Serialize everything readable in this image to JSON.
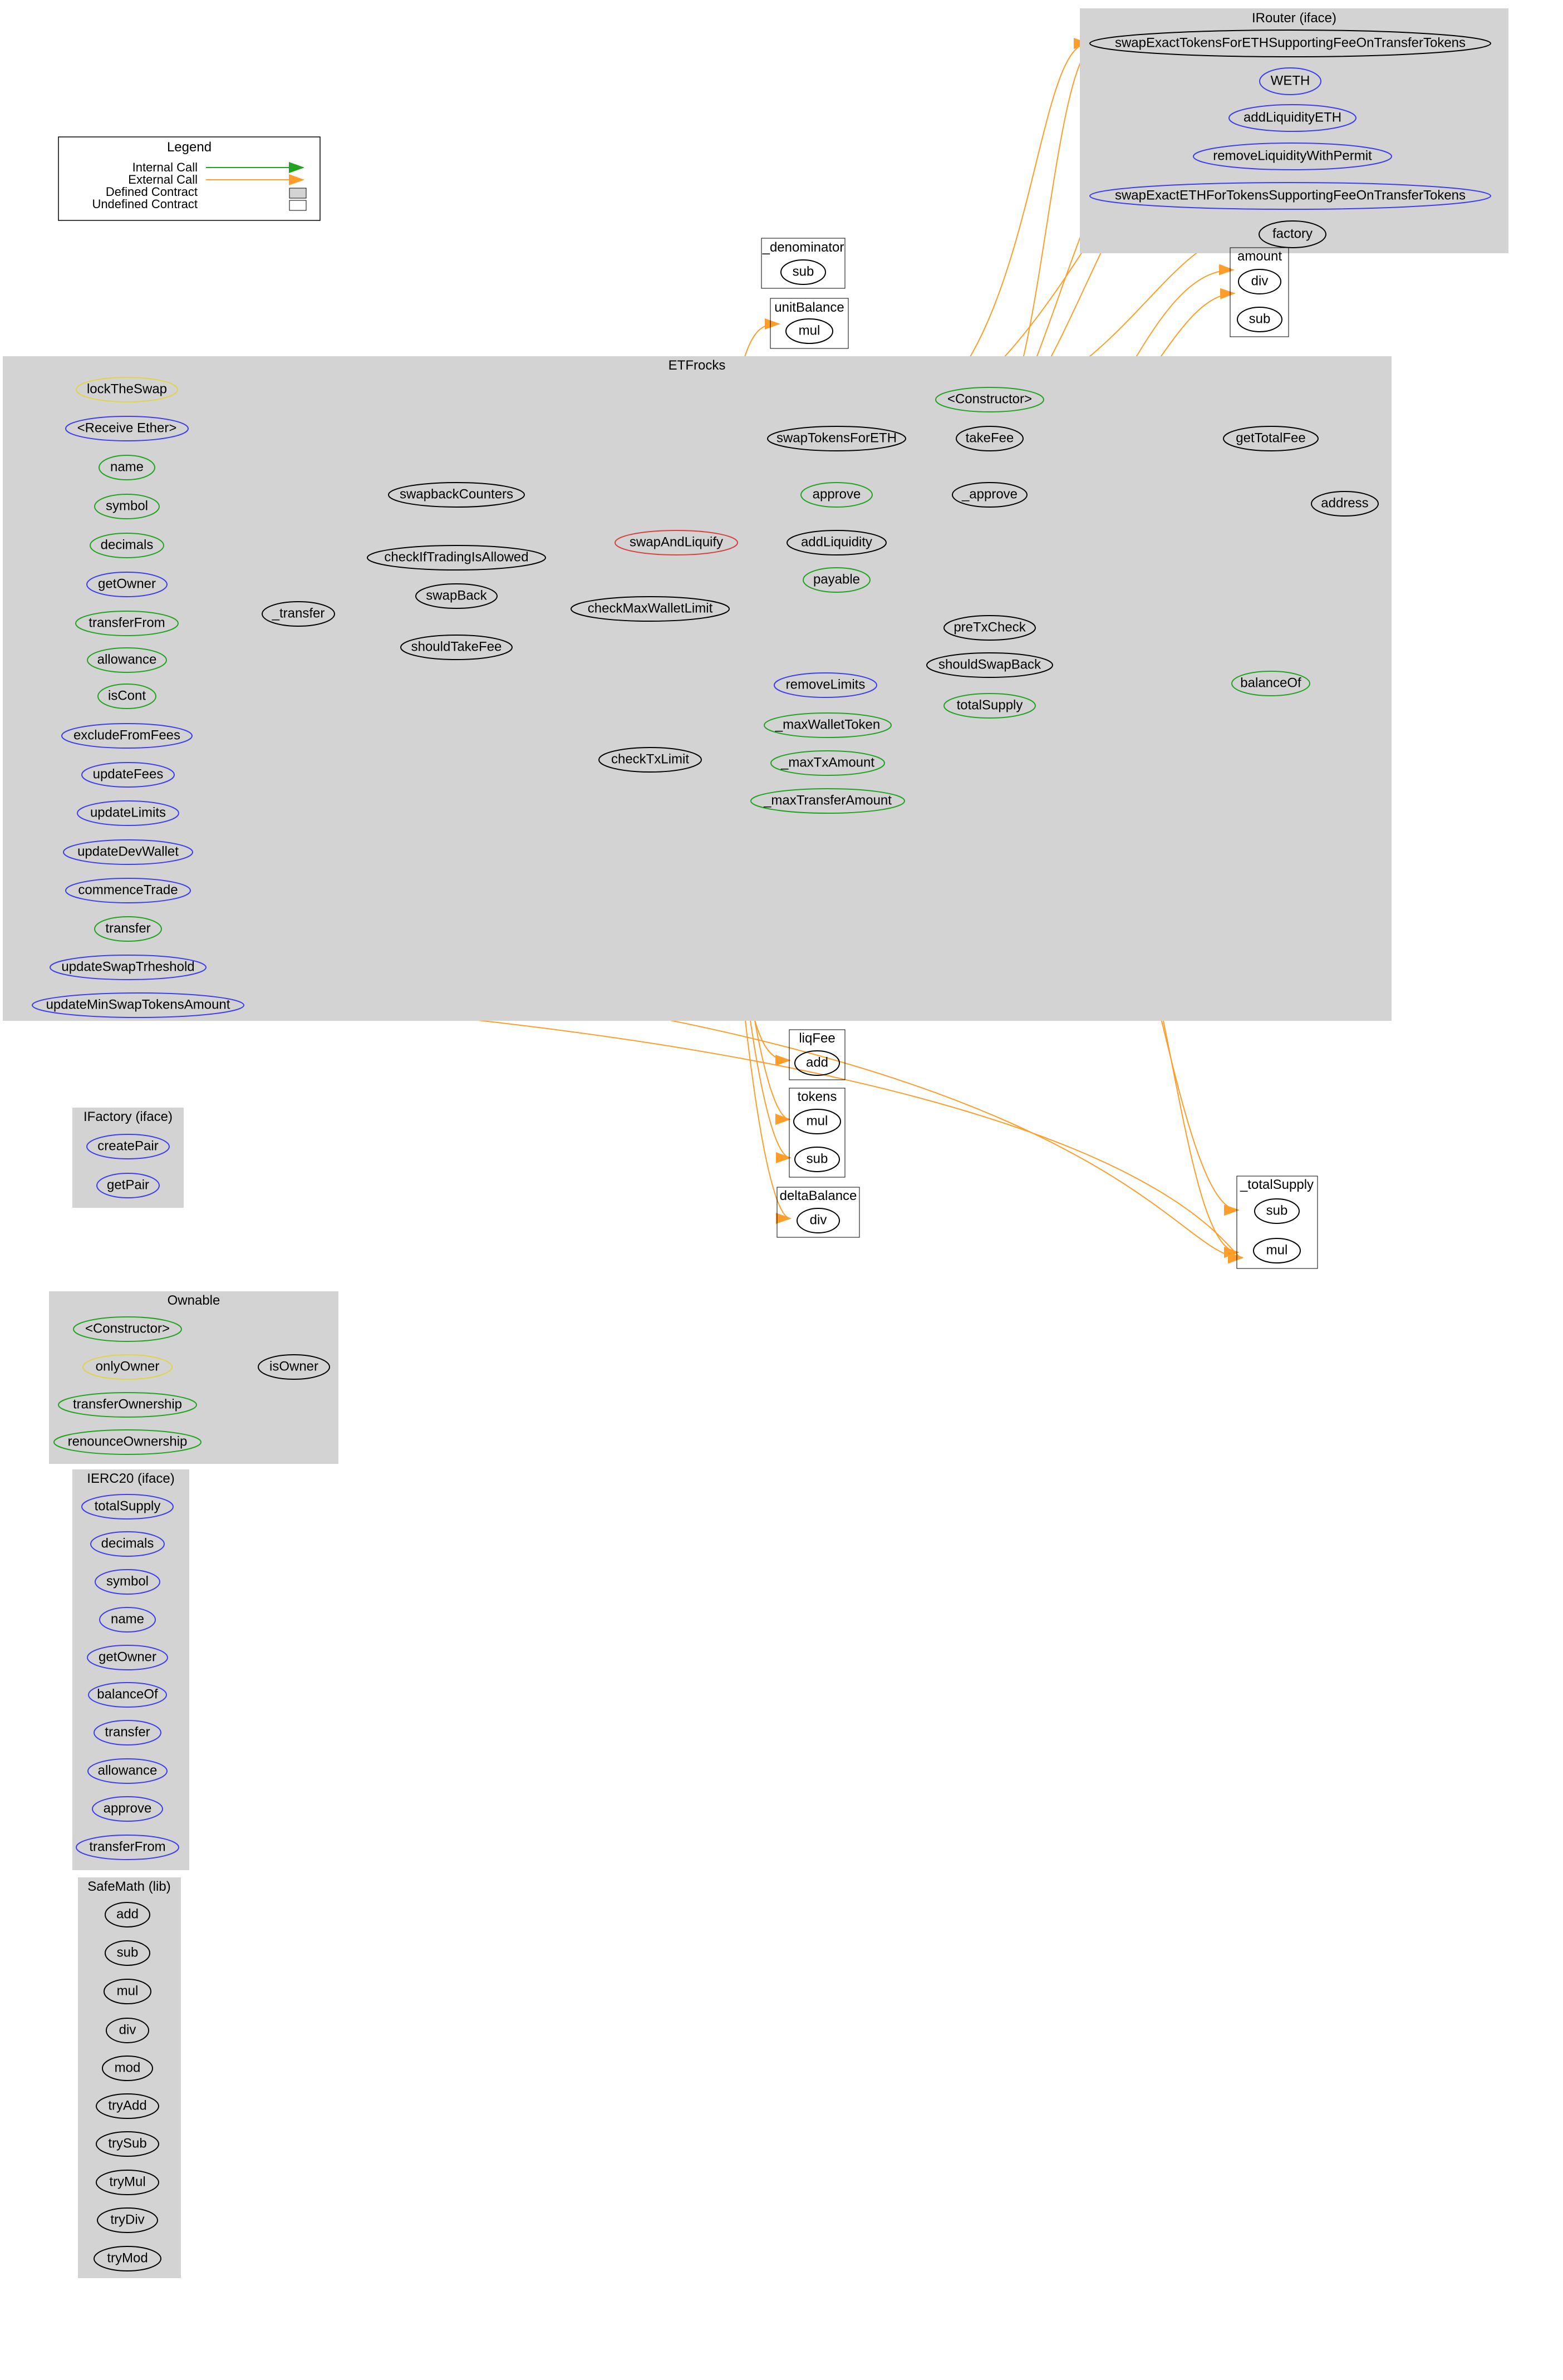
{
  "legend": {
    "title": "Legend",
    "items": {
      "internal_call": "Internal Call",
      "external_call": "External Call",
      "defined_contract": "Defined Contract",
      "undefined_contract": "Undefined Contract"
    }
  },
  "clusters": {
    "irouter": {
      "title": "IRouter   (iface)"
    },
    "etfrocks": {
      "title": "ETFrocks"
    },
    "ifactory": {
      "title": "IFactory   (iface)"
    },
    "ownable": {
      "title": "Ownable"
    },
    "ierc20": {
      "title": "IERC20   (iface)"
    },
    "safemath": {
      "title": "SafeMath   (lib)"
    },
    "denominator": {
      "title": "_denominator"
    },
    "unitbalance": {
      "title": "unitBalance"
    },
    "amount": {
      "title": "amount"
    },
    "liqfee": {
      "title": "liqFee"
    },
    "tokens": {
      "title": "tokens"
    },
    "deltabalance": {
      "title": "deltaBalance"
    },
    "totalsupply_lib": {
      "title": "_totalSupply"
    }
  },
  "nodes": {
    "irouter_swapExactTokens": "swapExactTokensForETHSupportingFeeOnTransferTokens",
    "irouter_weth": "WETH",
    "irouter_addLiquidityETH": "addLiquidityETH",
    "irouter_removeLiquidity": "removeLiquidityWithPermit",
    "irouter_swapExactETH": "swapExactETHForTokensSupportingFeeOnTransferTokens",
    "irouter_factory": "factory",
    "denom_sub": "sub",
    "unit_mul": "mul",
    "amount_div": "div",
    "amount_sub": "sub",
    "etf_lockTheSwap": "lockTheSwap",
    "etf_receive": "<Receive Ether>",
    "etf_name": "name",
    "etf_symbol": "symbol",
    "etf_decimals": "decimals",
    "etf_getOwner": "getOwner",
    "etf_transferFrom": "transferFrom",
    "etf_allowance": "allowance",
    "etf_isCont": "isCont",
    "etf_excludeFromFees": "excludeFromFees",
    "etf_updateFees": "updateFees",
    "etf_updateLimits": "updateLimits",
    "etf_updateDevWallet": "updateDevWallet",
    "etf_commenceTrade": "commenceTrade",
    "etf_transfer2": "transfer",
    "etf_updateSwapTrheshold": "updateSwapTrheshold",
    "etf_updateMinSwap": "updateMinSwapTokensAmount",
    "etf_transfer": "_transfer",
    "etf_swapbackCounters": "swapbackCounters",
    "etf_checkTrading": "checkIfTradingIsAllowed",
    "etf_swapBack": "swapBack",
    "etf_shouldTakeFee": "shouldTakeFee",
    "etf_swapAndLiquify": "swapAndLiquify",
    "etf_checkMaxWallet": "checkMaxWalletLimit",
    "etf_checkTxLimit": "checkTxLimit",
    "etf_swapTokensForETH": "swapTokensForETH",
    "etf_approve2": "approve",
    "etf_addLiquidity": "addLiquidity",
    "etf_payable": "payable",
    "etf_removeLimits": "removeLimits",
    "etf_maxWalletToken": "_maxWalletToken",
    "etf_maxTxAmount": "_maxTxAmount",
    "etf_maxTransferAmount": "_maxTransferAmount",
    "etf_constructor": "<Constructor>",
    "etf_takeFee": "takeFee",
    "etf_approve": "_approve",
    "etf_preTxCheck": "preTxCheck",
    "etf_shouldSwapBack": "shouldSwapBack",
    "etf_totalSupply": "totalSupply",
    "etf_getTotalFee": "getTotalFee",
    "etf_address": "address",
    "etf_balanceOf": "balanceOf",
    "liqfee_add": "add",
    "tokens_mul": "mul",
    "tokens_sub": "sub",
    "delta_div": "div",
    "ts_sub": "sub",
    "ts_mul": "mul",
    "ifactory_createPair": "createPair",
    "ifactory_getPair": "getPair",
    "ownable_constructor": "<Constructor>",
    "ownable_onlyOwner": "onlyOwner",
    "ownable_transferOwnership": "transferOwnership",
    "ownable_renounceOwnership": "renounceOwnership",
    "ownable_isOwner": "isOwner",
    "ierc20_totalSupply": "totalSupply",
    "ierc20_decimals": "decimals",
    "ierc20_symbol": "symbol",
    "ierc20_name": "name",
    "ierc20_getOwner": "getOwner",
    "ierc20_balanceOf": "balanceOf",
    "ierc20_transfer": "transfer",
    "ierc20_allowance": "allowance",
    "ierc20_approve": "approve",
    "ierc20_transferFrom": "transferFrom",
    "sm_add": "add",
    "sm_sub": "sub",
    "sm_mul": "mul",
    "sm_div": "div",
    "sm_mod": "mod",
    "sm_tryAdd": "tryAdd",
    "sm_trySub": "trySub",
    "sm_tryMul": "tryMul",
    "sm_tryDiv": "tryDiv",
    "sm_tryMod": "tryMod"
  }
}
